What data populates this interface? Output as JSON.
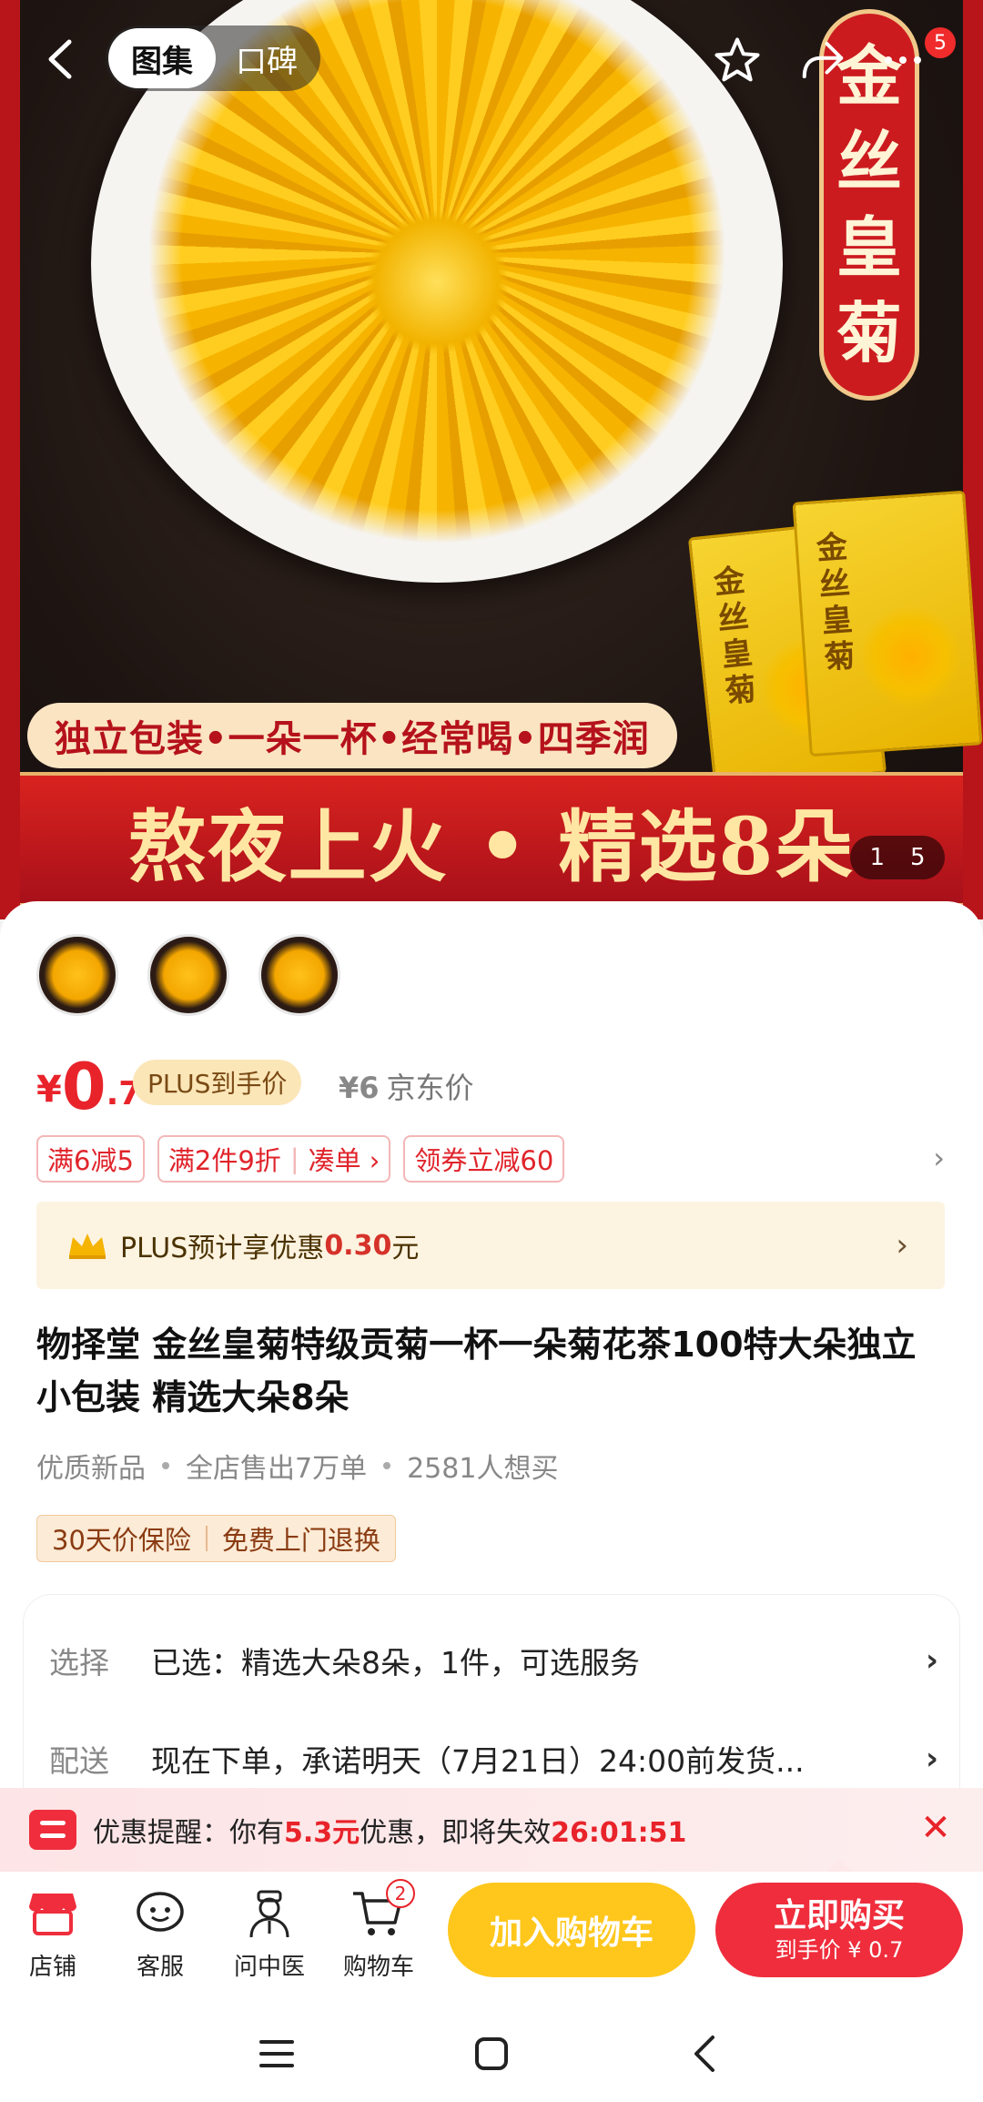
{
  "nav": {
    "tab_active": "图集",
    "tab_other": "口碑",
    "notification_count": "5"
  },
  "hero": {
    "vertical_badge": [
      "金",
      "丝",
      "皇",
      "菊"
    ],
    "pack_text": "金丝皇菊",
    "tagline": "独立包装•一朵一杯•经常喝•四季润",
    "banner": "熬夜上火 • 精选8朵",
    "counter_current": "1",
    "counter_total": "5"
  },
  "price": {
    "currency": "¥",
    "integer": "0",
    "decimal": ".7",
    "plus_tag": "PLUS到手价",
    "jd_price": "¥6",
    "jd_label": "京东价"
  },
  "promos": {
    "p1": "满6减5",
    "p2_main": "满2件9折",
    "p2_action": "凑单 ›",
    "p3": "领券立减60",
    "arrow": "›"
  },
  "plus_bar": {
    "text": "PLUS预计享优惠",
    "amount": "0.30",
    "unit": "元",
    "arrow": "›"
  },
  "product": {
    "title": "物择堂 金丝皇菊特级贡菊一杯一朵菊花茶100特大朵独立小包装 精选大朵8朵",
    "meta1": "优质新品",
    "meta2": "全店售出7万单",
    "meta3": "2581人想买",
    "service1": "30天价保险",
    "service2": "免费上门退换"
  },
  "options": {
    "select_label": "选择",
    "select_value": "已选：精选大朵8朵，1件，可选服务",
    "delivery_label": "配送",
    "delivery_value": "现在下单，承诺明天（7月21日）24:00前发货...",
    "arrow": "›"
  },
  "reminder": {
    "prefix": "优惠提醒：你有",
    "amount": "5.3元",
    "middle": "优惠，即将失效",
    "countdown": "26:01:51",
    "close": "✕"
  },
  "actionbar": {
    "store": "店铺",
    "service": "客服",
    "doctor": "问中医",
    "cart": "购物车",
    "cart_count": "2",
    "add_to_cart": "加入购物车",
    "buy_now": "立即购买",
    "buy_sub": "到手价 ¥ 0.7"
  },
  "colors": {
    "accent_red": "#e8232a",
    "cart_yellow": "#ffc71c",
    "buy_red": "#ef2d3c"
  }
}
